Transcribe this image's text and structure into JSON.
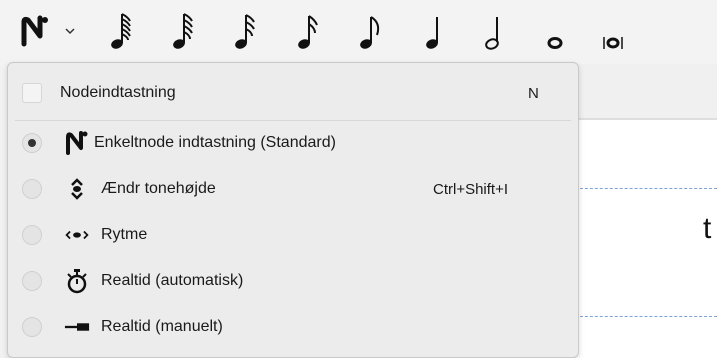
{
  "toolbar": {
    "input_mode_icon": "note-input-n-icon",
    "note_durations": [
      {
        "name": "1024th-note-icon"
      },
      {
        "name": "512th-note-icon"
      },
      {
        "name": "256th-note-icon"
      },
      {
        "name": "128th-note-icon"
      },
      {
        "name": "eighth-note-icon"
      },
      {
        "name": "quarter-note-icon"
      },
      {
        "name": "half-note-icon"
      },
      {
        "name": "whole-note-icon"
      },
      {
        "name": "breve-note-icon"
      }
    ]
  },
  "menu": {
    "header": {
      "label": "Nodeindtastning",
      "shortcut": "N",
      "checked": false
    },
    "items": [
      {
        "label": "Enkeltnode indtastning (Standard)",
        "shortcut": "",
        "selected": true,
        "icon": "note-input-n-icon"
      },
      {
        "label": "Ændr tonehøjde",
        "shortcut": "Ctrl+Shift+I",
        "selected": false,
        "icon": "pitch-updown-icon"
      },
      {
        "label": "Rytme",
        "shortcut": "",
        "selected": false,
        "icon": "rhythm-icon"
      },
      {
        "label": "Realtid (automatisk)",
        "shortcut": "",
        "selected": false,
        "icon": "stopwatch-icon"
      },
      {
        "label": "Realtid (manuelt)",
        "shortcut": "",
        "selected": false,
        "icon": "realtime-manual-icon"
      }
    ]
  },
  "score": {
    "visible_text": "t"
  },
  "colors": {
    "staff_line": "#7fa2d6",
    "menu_bg": "#ececec",
    "toolbar_bg": "#f3f3f3"
  }
}
